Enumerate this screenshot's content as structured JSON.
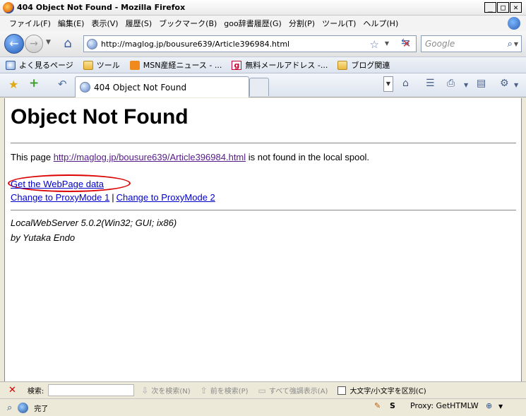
{
  "window": {
    "title": "404 Object Not Found - Mozilla Firefox"
  },
  "menu": [
    "ファイル(F)",
    "編集(E)",
    "表示(V)",
    "履歴(S)",
    "ブックマーク(B)",
    "goo辞書履歴(G)",
    "分割(P)",
    "ツール(T)",
    "ヘルプ(H)"
  ],
  "nav": {
    "url": "http://maglog.jp/bousure639/Article396984.html",
    "search_placeholder": "Google"
  },
  "bookmarks": [
    "よく見るページ",
    "ツール",
    "MSN産経ニュース - ...",
    "無料メールアドレス -...",
    "ブログ関連"
  ],
  "tab": {
    "title": "404 Object Not Found"
  },
  "page": {
    "heading": "Object Not Found",
    "msg_prefix": "This page ",
    "msg_link": "http://maglog.jp/bousure639/Article396984.html",
    "msg_suffix": " is not found in the local spool.",
    "get_link": "Get the WebPage data",
    "proxy1": "Change to ProxyMode 1",
    "separator": "|",
    "proxy2": "Change to ProxyMode 2",
    "server": "LocalWebServer 5.0.2(Win32; GUI; ix86)",
    "author": "by Yutaka Endo"
  },
  "findbar": {
    "label": "検索:",
    "next": "次を検索(N)",
    "prev": "前を検索(P)",
    "highlight": "すべて強調表示(A)",
    "match_case": "大文字/小文字を区別(C)"
  },
  "status": {
    "text": "完了",
    "proxy": "Proxy: GetHTMLW"
  }
}
